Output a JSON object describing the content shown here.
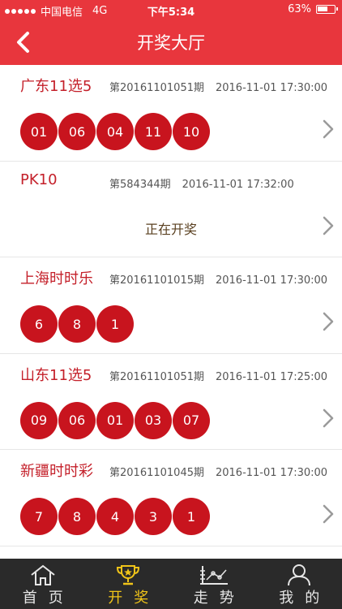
{
  "status": {
    "carrier": "中国电信",
    "network": "4G",
    "time": "下午5:34",
    "battery": "63%",
    "battery_level": 0.63
  },
  "header": {
    "title": "开奖大厅",
    "accent": "#e8363d"
  },
  "lotteries": [
    {
      "name": "广东11选5",
      "issue": "第20161101051期",
      "date": "2016-11-01 17:30:00",
      "numbers": [
        "01",
        "06",
        "04",
        "11",
        "10"
      ],
      "status": ""
    },
    {
      "name": "PK10",
      "issue": "第584344期",
      "date": "2016-11-01 17:32:00",
      "numbers": [],
      "status": "正在开奖"
    },
    {
      "name": "上海时时乐",
      "issue": "第20161101015期",
      "date": "2016-11-01 17:30:00",
      "numbers": [
        "6",
        "8",
        "1"
      ],
      "status": ""
    },
    {
      "name": "山东11选5",
      "issue": "第20161101051期",
      "date": "2016-11-01 17:25:00",
      "numbers": [
        "09",
        "06",
        "01",
        "03",
        "07"
      ],
      "status": ""
    },
    {
      "name": "新疆时时彩",
      "issue": "第20161101045期",
      "date": "2016-11-01 17:30:00",
      "numbers": [
        "7",
        "8",
        "4",
        "3",
        "1"
      ],
      "status": ""
    }
  ],
  "tabs": [
    {
      "label": "首页",
      "icon": "home-icon",
      "active": false
    },
    {
      "label": "开奖",
      "icon": "trophy-icon",
      "active": true
    },
    {
      "label": "走势",
      "icon": "trend-chart-icon",
      "active": false
    },
    {
      "label": "我的",
      "icon": "user-icon",
      "active": false
    }
  ]
}
